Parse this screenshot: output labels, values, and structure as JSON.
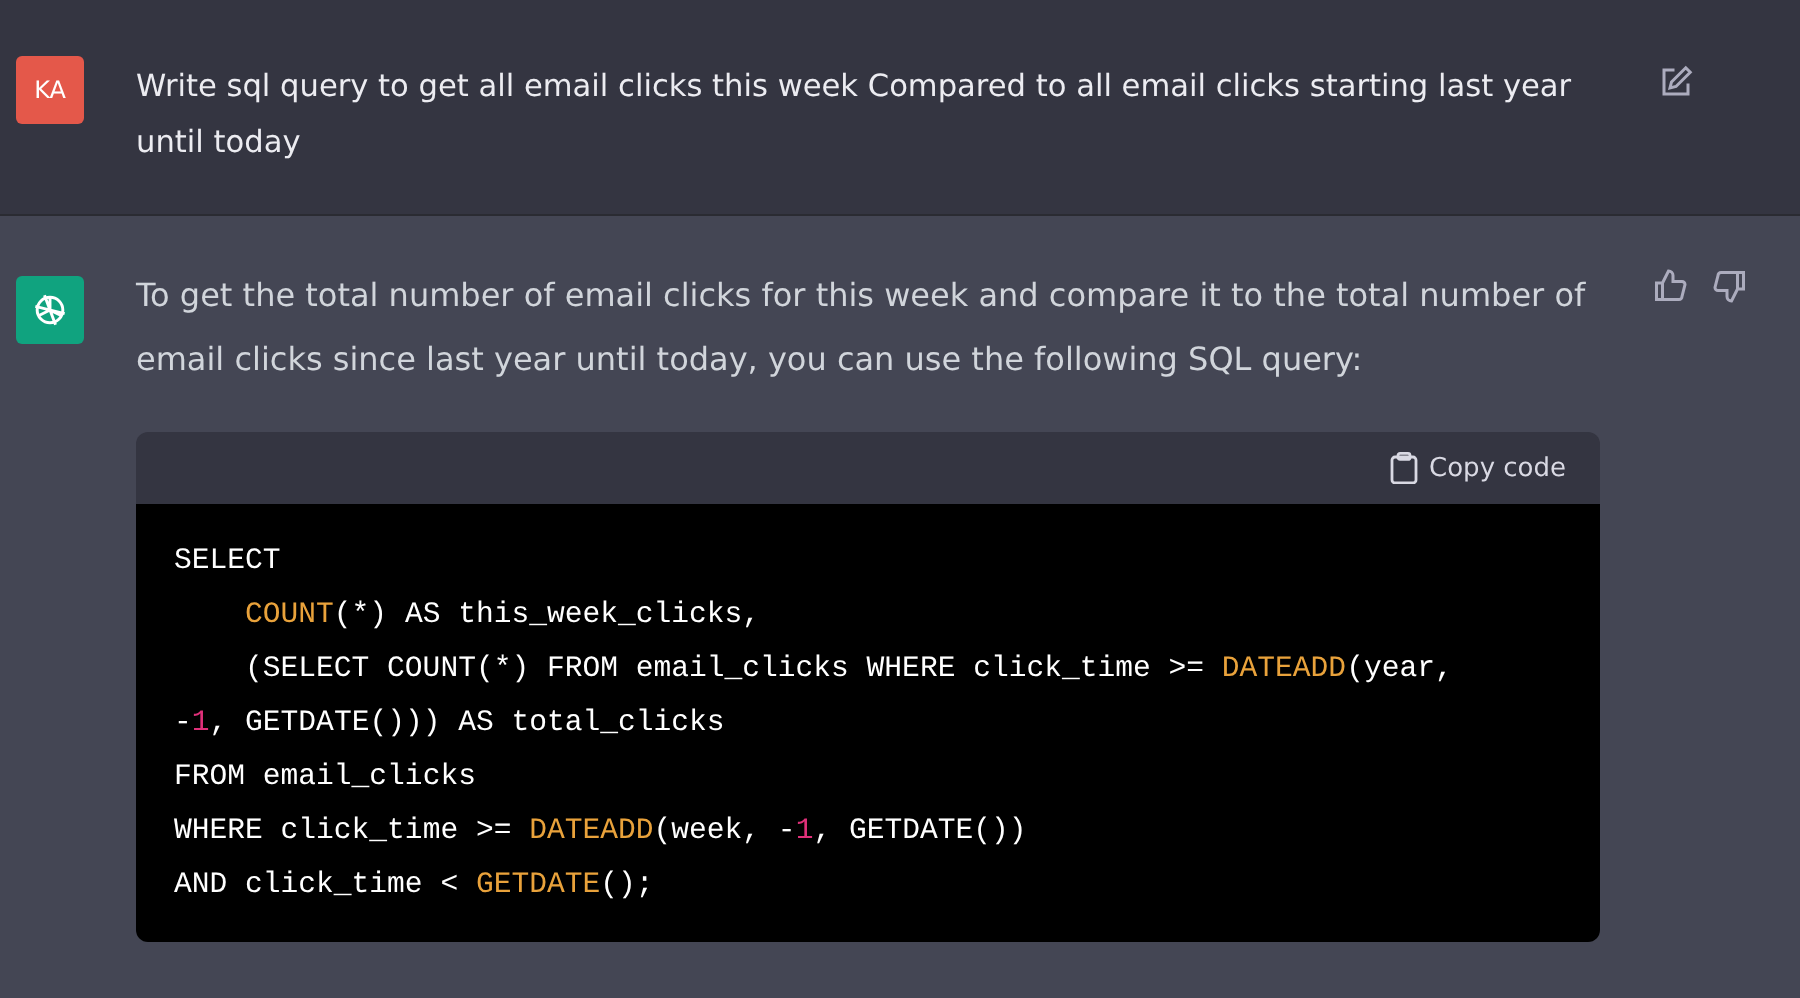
{
  "user_message": {
    "avatar": "KA",
    "text": "Write sql query to get all email clicks this week Compared to all email clicks starting last year until today"
  },
  "assistant_message": {
    "text": "To get the total number of email clicks for this week and compare it to the total number of email clicks since last year until today, you can use the following SQL query:",
    "code_block": {
      "copy_label": "Copy code",
      "lines": [
        [
          {
            "kind": "plain",
            "text": "SELECT"
          }
        ],
        [
          {
            "kind": "function",
            "text": "COUNT",
            "indent": true
          },
          {
            "kind": "plain",
            "text": "(*) AS this_week_clicks,"
          }
        ],
        [
          {
            "kind": "plain",
            "indent": true,
            "text": "(SELECT COUNT(*) FROM email_clicks WHERE click_time >= "
          },
          {
            "kind": "function",
            "text": "DATEADD"
          },
          {
            "kind": "plain",
            "text": "(year,"
          }
        ],
        [
          {
            "kind": "plain",
            "text": "-"
          },
          {
            "kind": "number",
            "text": "1"
          },
          {
            "kind": "plain",
            "text": ", GETDATE())) AS total_clicks"
          }
        ],
        [
          {
            "kind": "plain",
            "text": "FROM email_clicks"
          }
        ],
        [
          {
            "kind": "plain",
            "text": "WHERE click_time >= "
          },
          {
            "kind": "function",
            "text": "DATEADD"
          },
          {
            "kind": "plain",
            "text": "(week, -"
          },
          {
            "kind": "number",
            "text": "1"
          },
          {
            "kind": "plain",
            "text": ", GETDATE())"
          }
        ],
        [
          {
            "kind": "plain",
            "text": "AND click_time < "
          },
          {
            "kind": "function",
            "text": "GETDATE"
          },
          {
            "kind": "plain",
            "text": "();"
          }
        ]
      ]
    }
  }
}
